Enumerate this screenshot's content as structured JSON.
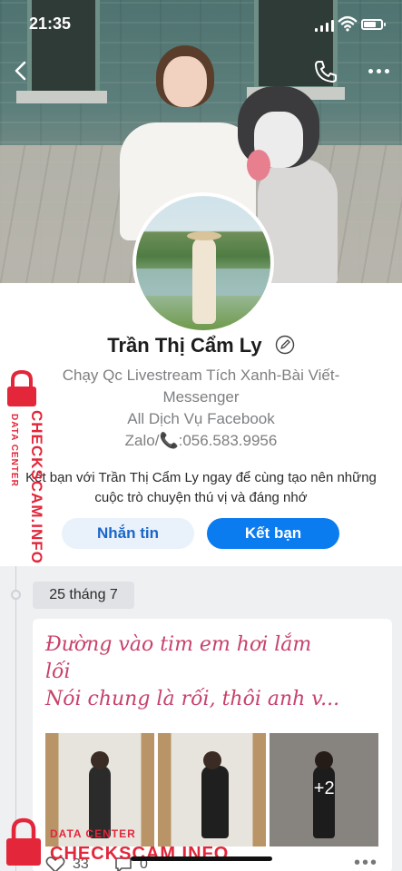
{
  "status_bar": {
    "time": "21:35"
  },
  "header": {
    "back_icon": "chevron-left-icon",
    "call_icon": "phone-icon",
    "more_icon": "more-horizontal-icon"
  },
  "profile": {
    "name": "Trần Thị Cẩm Ly",
    "edit_icon": "pencil-icon",
    "bio_lines": [
      "Chạy Qc Livestream Tích Xanh-Bài Viết-",
      "Messenger",
      "All Dịch Vụ Facebook",
      "Zalo/📞:056.583.9956"
    ]
  },
  "friend_prompt": {
    "text": "Kết bạn với Trần Thị Cẩm Ly ngay để cùng tạo nên những cuộc trò chuyện thú vị và đáng nhớ",
    "message_button": "Nhắn tin",
    "add_friend_button": "Kết bạn"
  },
  "feed": {
    "date_label": "25 tháng 7",
    "post": {
      "text_lines": [
        "Đường vào tim em hơi lắm",
        "lối",
        "Nói chung là rối, thôi anh v..."
      ],
      "extra_photos_label": "+2",
      "like_count": "33",
      "comment_count": "0"
    }
  },
  "watermark": {
    "main": "CHECKSCAM.INFO",
    "sub": "DATA CENTER"
  },
  "colors": {
    "accent_blue": "#0b7cf0",
    "post_text_pink": "#c8426b",
    "watermark_red": "#e3263a"
  }
}
